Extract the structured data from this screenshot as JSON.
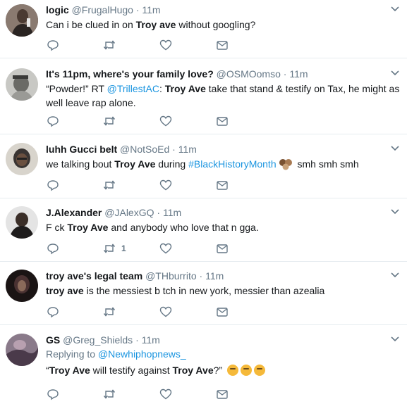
{
  "tweets": [
    {
      "name": "logic",
      "handle": "@FrugalHugo",
      "time": "11m",
      "text_parts": [
        "Can i be clued in on ",
        "Troy ave",
        " without googling?"
      ],
      "retweets": "",
      "avatar_color": "#5a4a44"
    },
    {
      "name": "It's 11pm, where's your family love?",
      "handle": "@OSMOomso",
      "time": "11m",
      "line1_a": "“Powder!” RT ",
      "line1_link": "@TrillestAC",
      "line1_b": ": ",
      "line1_bold": "Troy Ave",
      "line1_c": " take that stand & testify on Tax, he might as",
      "line2": "well leave rap alone.",
      "retweets": "",
      "avatar_color": "#b0b0b0"
    },
    {
      "name": "luhh Gucci belt",
      "handle": "@NotSoEd",
      "time": "11m",
      "text_a": "we talking bout ",
      "text_bold": "Troy Ave",
      "text_b": " during ",
      "hashtag": "#BlackHistoryMonth",
      "text_c": " smh smh smh",
      "retweets": "",
      "avatar_color": "#3a3533"
    },
    {
      "name": "J.Alexander",
      "handle": "@JAlexGQ",
      "time": "11m",
      "text_a": "F  ck ",
      "text_bold": "Troy Ave",
      "text_b": " and anybody who love that n  gga.",
      "retweets": "1",
      "avatar_color": "#2e2a28"
    },
    {
      "name": "troy ave's legal team",
      "handle": "@THburrito",
      "time": "11m",
      "text_bold": "troy ave",
      "text_b": " is the messiest b  tch in new york, messier than azealia",
      "retweets": "",
      "avatar_color": "#3b2f2e"
    },
    {
      "name": "GS",
      "handle": "@Greg_Shields",
      "time": "11m",
      "replying_label": "Replying to ",
      "replying_handle": "@Newhiphopnews_",
      "q_open": "“",
      "bold1": "Troy Ave",
      "mid": " will testify against ",
      "bold2": "Troy Ave",
      "q_close": "?”",
      "retweets": "",
      "avatar_color": "#6e5a6a"
    }
  ],
  "colors": {
    "icon": "#657786",
    "link": "#1b95e0",
    "divider": "#e6ecf0"
  },
  "icons": [
    "reply-icon",
    "retweet-icon",
    "like-icon",
    "direct-message-icon",
    "chevron-down-icon"
  ]
}
